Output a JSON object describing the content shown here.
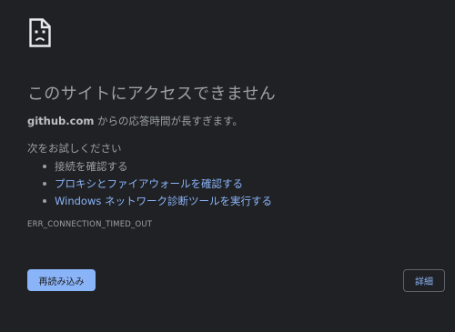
{
  "icon": "sad-page-icon",
  "title": "このサイトにアクセスできません",
  "description": {
    "host": "github.com",
    "message": " からの応答時間が長すぎます。"
  },
  "try_title": "次をお試しください",
  "suggestions": {
    "check_connection": "接続を確認する",
    "check_proxy_firewall": "プロキシとファイアウォールを確認する",
    "run_diagnostics": "Windows ネットワーク診断ツールを実行する"
  },
  "error_code": "ERR_CONNECTION_TIMED_OUT",
  "buttons": {
    "reload": "再読み込み",
    "details": "詳細"
  },
  "colors": {
    "background": "#202124",
    "text": "#9aa0a6",
    "link": "#8ab4f8",
    "primary_button": "#8ab4f8"
  }
}
